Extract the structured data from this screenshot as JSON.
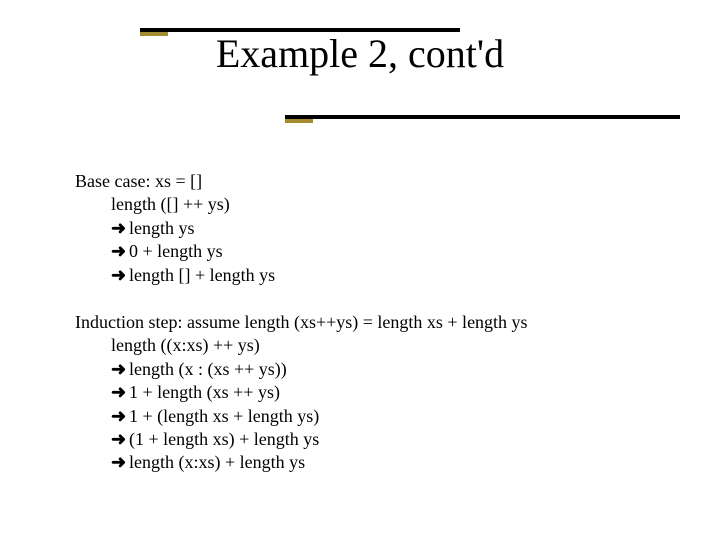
{
  "title": "Example 2, cont'd",
  "base": {
    "lead": "Base case:  xs = []",
    "step1": "length ([] ++ ys)",
    "step2": "length ys",
    "step3": "0 + length ys",
    "step4": "length [] + length ys"
  },
  "induction": {
    "lead": "Induction step:  assume length (xs++ys) = length xs + length ys",
    "step1": "length ((x:xs) ++ ys)",
    "step2": "length (x : (xs ++ ys))",
    "step3": "1 + length (xs ++ ys)",
    "step4": "1 + (length xs + length ys)",
    "step5": "(1 + length xs) + length ys",
    "step6": "length (x:xs) + length ys"
  },
  "glyphs": {
    "arrow": "➜"
  }
}
